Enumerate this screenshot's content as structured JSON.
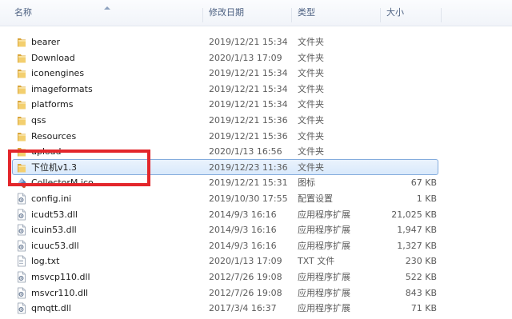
{
  "header": {
    "col_name": "名称",
    "col_date": "修改日期",
    "col_type": "类型",
    "col_size": "大小"
  },
  "rows": [
    {
      "name": "bearer",
      "date": "2019/12/21 15:34",
      "type": "文件夹",
      "size": "",
      "icon": "folder-icon"
    },
    {
      "name": "Download",
      "date": "2020/1/13 17:09",
      "type": "文件夹",
      "size": "",
      "icon": "folder-icon"
    },
    {
      "name": "iconengines",
      "date": "2019/12/21 15:34",
      "type": "文件夹",
      "size": "",
      "icon": "folder-icon"
    },
    {
      "name": "imageformats",
      "date": "2019/12/21 15:34",
      "type": "文件夹",
      "size": "",
      "icon": "folder-icon"
    },
    {
      "name": "platforms",
      "date": "2019/12/21 15:34",
      "type": "文件夹",
      "size": "",
      "icon": "folder-icon"
    },
    {
      "name": "qss",
      "date": "2019/12/21 15:36",
      "type": "文件夹",
      "size": "",
      "icon": "folder-icon"
    },
    {
      "name": "Resources",
      "date": "2019/12/21 15:36",
      "type": "文件夹",
      "size": "",
      "icon": "folder-icon"
    },
    {
      "name": "upload",
      "date": "2020/1/13 16:56",
      "type": "文件夹",
      "size": "",
      "icon": "folder-icon"
    },
    {
      "name": "下位机v1.3",
      "date": "2019/12/23 11:36",
      "type": "文件夹",
      "size": "",
      "icon": "folder-icon",
      "selected": true
    },
    {
      "name": "CollectorM.ico",
      "date": "2019/12/21 15:31",
      "type": "图标",
      "size": "67 KB",
      "icon": "ico-file-icon"
    },
    {
      "name": "config.ini",
      "date": "2019/10/30 17:55",
      "type": "配置设置",
      "size": "1 KB",
      "icon": "ini-file-icon"
    },
    {
      "name": "icudt53.dll",
      "date": "2014/9/3 16:16",
      "type": "应用程序扩展",
      "size": "21,025 KB",
      "icon": "dll-file-icon"
    },
    {
      "name": "icuin53.dll",
      "date": "2014/9/3 16:16",
      "type": "应用程序扩展",
      "size": "1,947 KB",
      "icon": "dll-file-icon"
    },
    {
      "name": "icuuc53.dll",
      "date": "2014/9/3 16:16",
      "type": "应用程序扩展",
      "size": "1,327 KB",
      "icon": "dll-file-icon"
    },
    {
      "name": "log.txt",
      "date": "2020/1/13 17:09",
      "type": "TXT 文件",
      "size": "230 KB",
      "icon": "txt-file-icon"
    },
    {
      "name": "msvcp110.dll",
      "date": "2012/7/26 19:08",
      "type": "应用程序扩展",
      "size": "522 KB",
      "icon": "dll-file-icon"
    },
    {
      "name": "msvcr110.dll",
      "date": "2012/7/26 19:08",
      "type": "应用程序扩展",
      "size": "843 KB",
      "icon": "dll-file-icon"
    },
    {
      "name": "qmqtt.dll",
      "date": "2017/3/4 16:37",
      "type": "应用程序扩展",
      "size": "71 KB",
      "icon": "dll-file-icon"
    }
  ],
  "colors": {
    "highlight_border": "#e3262b",
    "selection_border": "#84acdd",
    "folder": "#e8b84a"
  }
}
